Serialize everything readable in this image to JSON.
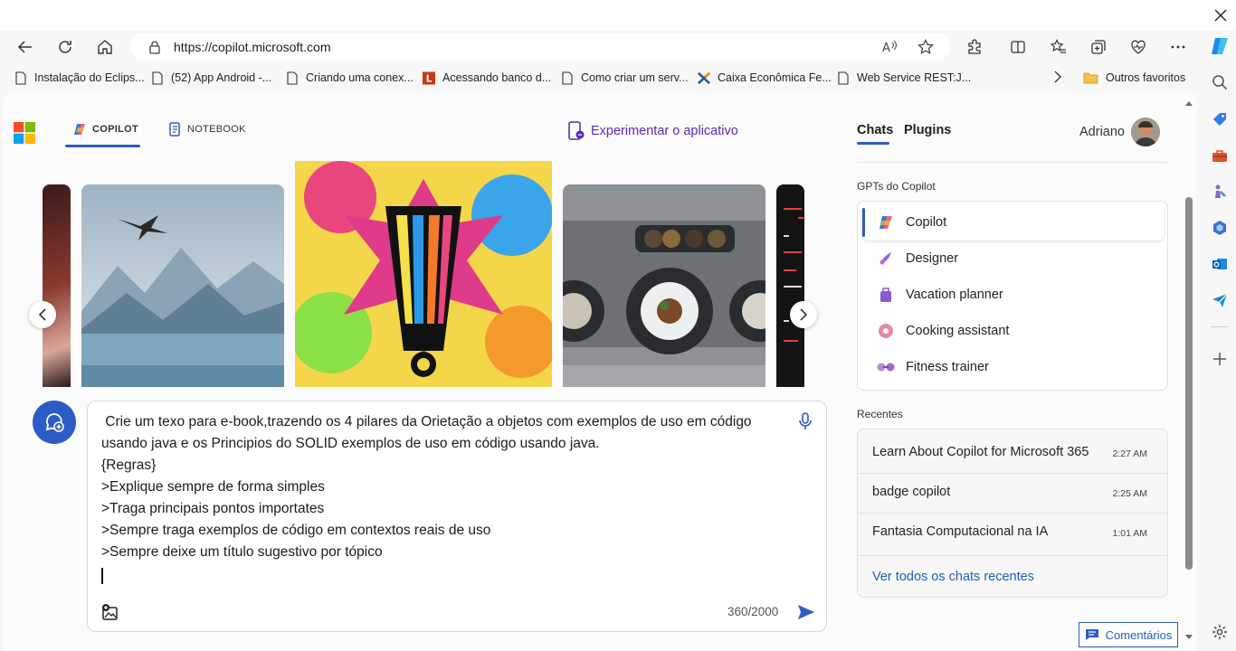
{
  "browser": {
    "url": "https://copilot.microsoft.com",
    "bookmarks": [
      {
        "label": "Instalação do Eclips..."
      },
      {
        "label": "(52) App Android -..."
      },
      {
        "label": "Criando uma conex..."
      },
      {
        "label": "Acessando banco d..."
      },
      {
        "label": "Como criar um serv..."
      },
      {
        "label": "Caixa Econômica Fe..."
      },
      {
        "label": "Web Service REST:J..."
      }
    ],
    "other_favorites": "Outros favoritos"
  },
  "header": {
    "tabs": [
      {
        "label": "COPILOT",
        "active": true
      },
      {
        "label": "NOTEBOOK",
        "active": false
      }
    ],
    "try_app": "Experimentar o aplicativo"
  },
  "composer": {
    "prompt_lines": [
      " Crie um texo para e-book,trazendo os 4 pilares da Orietação a objetos com exemplos de uso em código",
      "usando java e os Principios do SOLID exemplos de uso em código usando java.",
      "{Regras}",
      ">Explique sempre de forma simples",
      ">Traga principais pontos importates",
      ">Sempre traga exemplos de código em contextos reais de uso",
      ">Sempre deixe um título sugestivo por tópico"
    ],
    "char_count": "360/2000"
  },
  "sidepanel": {
    "tabs": [
      {
        "label": "Chats",
        "active": true
      },
      {
        "label": "Plugins",
        "active": false
      }
    ],
    "user_name": "Adriano",
    "gpts_heading": "GPTs do Copilot",
    "gpts": [
      {
        "label": "Copilot",
        "selected": true,
        "icon": "copilot-icon"
      },
      {
        "label": "Designer",
        "selected": false,
        "icon": "designer-icon"
      },
      {
        "label": "Vacation planner",
        "selected": false,
        "icon": "suitcase-icon"
      },
      {
        "label": "Cooking assistant",
        "selected": false,
        "icon": "donut-icon"
      },
      {
        "label": "Fitness trainer",
        "selected": false,
        "icon": "dumbbell-icon"
      }
    ],
    "recents_heading": "Recentes",
    "recents": [
      {
        "title": "Learn About Copilot for Microsoft 365",
        "time": "2:27 AM"
      },
      {
        "title": "badge copilot",
        "time": "2:25 AM"
      },
      {
        "title": "Fantasia Computacional na IA",
        "time": "1:01 AM"
      }
    ],
    "see_all": "Ver todos os chats recentes"
  },
  "feedback": "Comentários",
  "colors": {
    "accent": "#2c5cc5",
    "link": "#1f5fbf",
    "selected_bar": "#2c5cc5"
  }
}
